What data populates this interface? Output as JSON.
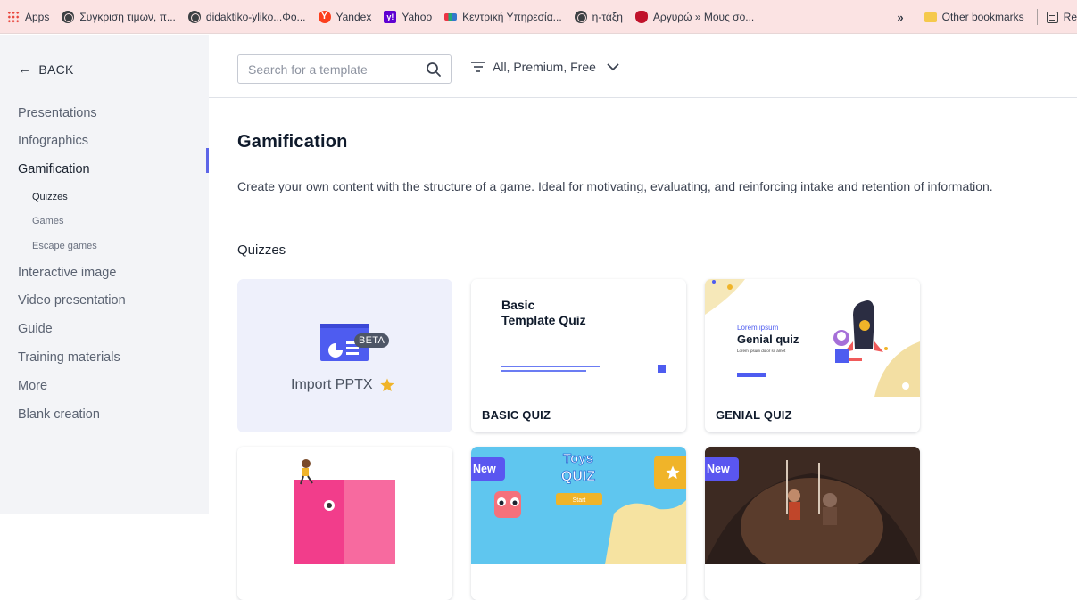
{
  "bookmarks": {
    "items": [
      {
        "label": "Apps",
        "icon": "apps-grid-icon"
      },
      {
        "label": "Συγκριση τιμων, π...",
        "icon": "globe-icon"
      },
      {
        "label": "didaktiko-yliko...Φο...",
        "icon": "globe-icon"
      },
      {
        "label": "Yandex",
        "icon": "yandex-icon"
      },
      {
        "label": "Yahoo",
        "icon": "yahoo-icon"
      },
      {
        "label": "Κεντρική Υπηρεσία...",
        "icon": "sch-icon"
      },
      {
        "label": "η-τάξη",
        "icon": "globe-icon"
      },
      {
        "label": "Αργυρώ » Μους σο...",
        "icon": "argyro-icon"
      }
    ],
    "overflow": "»",
    "other": "Other bookmarks",
    "reading": "Re"
  },
  "sidebar": {
    "back": "BACK",
    "items": [
      {
        "label": "Presentations"
      },
      {
        "label": "Infographics"
      },
      {
        "label": "Gamification"
      },
      {
        "label": "Quizzes"
      },
      {
        "label": "Games"
      },
      {
        "label": "Escape games"
      },
      {
        "label": "Interactive image"
      },
      {
        "label": "Video presentation"
      },
      {
        "label": "Guide"
      },
      {
        "label": "Training materials"
      },
      {
        "label": "More"
      },
      {
        "label": "Blank creation"
      }
    ]
  },
  "search": {
    "placeholder": "Search for a template"
  },
  "filter": {
    "label": "All, Premium, Free"
  },
  "main": {
    "title": "Gamification",
    "description": "Create your own content with the structure of a game. Ideal for motivating, evaluating, and reinforcing intake and retention of information.",
    "section": "Quizzes"
  },
  "cards": {
    "import": {
      "label": "Import PPTX",
      "badge": "BETA"
    },
    "basic": {
      "label": "BASIC QUIZ",
      "thumb_title": "Basic\nTemplate Quiz"
    },
    "genial": {
      "label": "GENIAL QUIZ",
      "thumb_small": "Lorem ipsum",
      "thumb_title": "Genial quiz",
      "thumb_sub": "Lorem ipsum dolor sit amet"
    },
    "toys": {
      "badge": "New",
      "thumb_title1": "Toys",
      "thumb_title2": "QUIZ",
      "thumb_button": "Start"
    },
    "cave": {
      "badge": "New"
    }
  },
  "colors": {
    "accent": "#5d65e8",
    "new_badge": "#5a56f0",
    "star": "#f0b429",
    "sidebar_bg": "#f3f4f7"
  }
}
